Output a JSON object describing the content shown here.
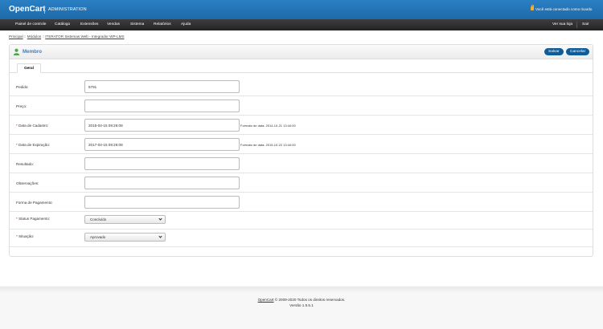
{
  "header": {
    "logo": "OpenCart",
    "subtitle": "ADMINISTRATION",
    "login_text": "Você está conectado como ricardo"
  },
  "menu": {
    "items": [
      "Painel de controle",
      "Catálogo",
      "Extensões",
      "Vendas",
      "Sistema",
      "Relatórios",
      "Ajuda"
    ],
    "right": [
      "Ver sua loja",
      "Sair"
    ]
  },
  "breadcrumb": {
    "items": [
      "Principal",
      "Módulos",
      "ITERATOR Sistemas Web - Integrador WP-LMS"
    ],
    "separator": "::"
  },
  "box": {
    "title": "Membro",
    "save_label": "Salvar",
    "cancel_label": "Cancelar",
    "tab_label": "Geral"
  },
  "form": {
    "fields": [
      {
        "label": "Pedido:",
        "required": false,
        "value": "5791",
        "hint": ""
      },
      {
        "label": "Preço:",
        "required": false,
        "value": "",
        "hint": ""
      },
      {
        "label": "Data de Cadastro:",
        "required": true,
        "value": "2015-04-15 09:26:08",
        "hint": "Formato de data: 2014-10-21 13:44:00"
      },
      {
        "label": "Data de Expiração:",
        "required": true,
        "value": "2017-04-15 09:26:08",
        "hint": "Formato de data: 2015-10-22 13:44:00"
      },
      {
        "label": "Resultado:",
        "required": false,
        "value": "",
        "hint": ""
      },
      {
        "label": "Observações:",
        "required": false,
        "value": "",
        "hint": ""
      },
      {
        "label": "Forma de Pagamento:",
        "required": false,
        "value": "",
        "hint": ""
      }
    ],
    "selects": [
      {
        "label": "Status Pagamento:",
        "required": true,
        "value": "Concluído"
      },
      {
        "label": "Situação:",
        "required": true,
        "value": "Aprovado"
      }
    ]
  },
  "footer": {
    "link": "OpenCart",
    "text": "© 2009-2020 Todos os direitos reservados.",
    "version": "Versão 1.5.5.1"
  },
  "colors": {
    "header_blue": "#1e6aa8",
    "menu_dark": "#2d2d2d",
    "button_blue": "#0e5c9a",
    "title_blue": "#3a7fc0",
    "required_red": "#ff0000"
  }
}
